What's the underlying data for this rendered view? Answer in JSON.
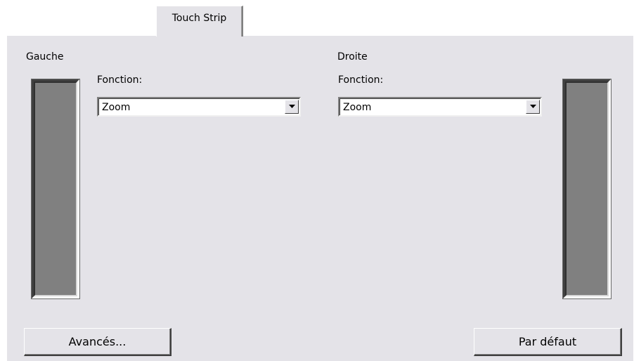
{
  "tab": {
    "label": "Touch Strip"
  },
  "left_group": {
    "legend": "Gauche",
    "function_label": "Fonction:",
    "function_value": "Zoom"
  },
  "right_group": {
    "legend": "Droite",
    "function_label": "Fonction:",
    "function_value": "Zoom"
  },
  "buttons": {
    "advanced": "Avancés...",
    "default": "Par défaut"
  },
  "icons": {
    "dropdown": "chevron-down-icon"
  },
  "colors": {
    "panel_bg": "#e4e3e8",
    "strip_fill": "#808080"
  }
}
